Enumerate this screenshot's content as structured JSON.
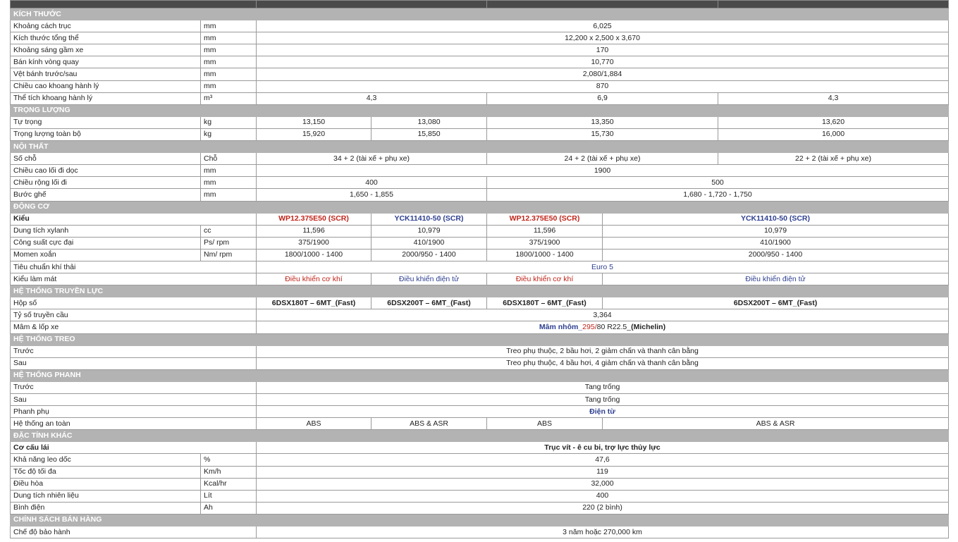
{
  "sections": {
    "dims": "KÍCH THƯỚC",
    "weight": "TRỌNG LƯỢNG",
    "interior": "NỘI THẤT",
    "engine": "ĐỘNG CƠ",
    "trans": "HỆ THỐNG TRUYỀN LỰC",
    "susp": "HỆ THỐNG TREO",
    "brake": "HỆ THỐNG PHANH",
    "other": "ĐẶC TÍNH KHÁC",
    "sales": "CHÍNH SÁCH BÁN HÀNG"
  },
  "rows": {
    "wheelbase": {
      "label": "Khoảng cách trục",
      "unit": "mm",
      "v": "6,025"
    },
    "overall": {
      "label": "Kích thước tổng thể",
      "unit": "mm",
      "v": "12,200 x 2,500 x 3,670"
    },
    "clearance": {
      "label": "Khoảng sáng gầm xe",
      "unit": "mm",
      "v": "170"
    },
    "turning": {
      "label": "Bán kính vòng quay",
      "unit": "mm",
      "v": "10,770"
    },
    "track": {
      "label": "Vệt bánh trước/sau",
      "unit": "mm",
      "v": "2,080/1,884"
    },
    "lugh": {
      "label": "Chiều cao khoang hành lý",
      "unit": "mm",
      "v": "870"
    },
    "lugv": {
      "label": "Thể tích khoang hành lý",
      "unit": "m³",
      "v1": "4,3",
      "v2": "6,9",
      "v3": "4,3"
    },
    "curb": {
      "label": "Tự trọng",
      "unit": "kg",
      "v1": "13,150",
      "v2": "13,080",
      "v3": "13,350",
      "v4": "13,620"
    },
    "gross": {
      "label": "Trọng lượng toàn bộ",
      "unit": "kg",
      "v1": "15,920",
      "v2": "15,850",
      "v3": "15,730",
      "v4": "16,000"
    },
    "seats": {
      "label": "Số chỗ",
      "unit": "Chỗ",
      "v1": "34 + 2 (tài xế + phụ xe)",
      "v2": "24 + 2 (tài xế + phụ xe)",
      "v3": "22 + 2 (tài xế + phụ xe)"
    },
    "aisleh": {
      "label": "Chiều cao lối đi dọc",
      "unit": "mm",
      "v": "1900"
    },
    "aislew": {
      "label": "Chiều rộng lối đi",
      "unit": "mm",
      "v1": "400",
      "v2": "500"
    },
    "pitch": {
      "label": "Bước ghế",
      "unit": "mm",
      "v1": "1,650 - 1,855",
      "v2": "1,680 - 1,720 - 1,750"
    },
    "etype": {
      "label": "Kiểu",
      "v1": "WP12.375E50 (SCR)",
      "v2": "YCK11410-50 (SCR)",
      "v3": "WP12.375E50 (SCR)",
      "v4": "YCK11410-50 (SCR)"
    },
    "disp": {
      "label": "Dung tích xylanh",
      "unit": "cc",
      "v1": "11,596",
      "v2": "10,979",
      "v3": "11,596",
      "v4": "10,979"
    },
    "power": {
      "label": "Công suất cực đại",
      "unit": "Ps/ rpm",
      "v1": "375/1900",
      "v2": "410/1900",
      "v3": "375/1900",
      "v4": "410/1900"
    },
    "torque": {
      "label": "Momen xoắn",
      "unit": "Nm/ rpm",
      "v1": "1800/1000 - 1400",
      "v2": "2000/950 - 1400",
      "v3": "1800/1000 - 1400",
      "v4": "2000/950 - 1400"
    },
    "emis": {
      "label": "Tiêu chuẩn khí thải",
      "v": "Euro 5"
    },
    "cool": {
      "label": "Kiểu làm mát",
      "v1": "Điều khiển cơ khí",
      "v2": "Điều khiển điện tử",
      "v3": "Điều khiển cơ khí",
      "v4": "Điều khiển điện tử"
    },
    "gearbox": {
      "label": "Hộp số",
      "v1": "6DSX180T – 6MT_(Fast)",
      "v2": "6DSX200T – 6MT_(Fast)",
      "v3": "6DSX180T – 6MT_(Fast)",
      "v4": "6DSX200T – 6MT_(Fast)"
    },
    "ratio": {
      "label": "Tỷ số truyền cầu",
      "v": "3,364"
    },
    "tyre": {
      "label": "Mâm & lốp xe",
      "a": "Mâm nhôm_",
      "b": "295/",
      "c": "80 R22.5_",
      "d": "(Michelin)"
    },
    "sfront": {
      "label": "Trước",
      "v": "Treo phụ thuộc, 2 bầu hơi, 2 giảm chấn và thanh cân bằng"
    },
    "srear": {
      "label": "Sau",
      "v": "Treo phụ thuộc, 4 bầu hơi, 4 giảm chấn và thanh cân bằng"
    },
    "bfront": {
      "label": "Trước",
      "v": "Tang trống"
    },
    "brear": {
      "label": "Sau",
      "v": "Tang trống"
    },
    "baux": {
      "label": "Phanh phụ",
      "v": "Điện từ"
    },
    "safety": {
      "label": "Hệ thống an toàn",
      "v1": "ABS",
      "v2": "ABS & ASR",
      "v3": "ABS",
      "v4": "ABS & ASR"
    },
    "steer": {
      "label": "Cơ cấu lái",
      "v": "Trục vít - ê cu bi, trợ lực thủy lực"
    },
    "grade": {
      "label": "Khả năng leo dốc",
      "unit": "%",
      "v": "47,6"
    },
    "speed": {
      "label": "Tốc độ tối đa",
      "unit": "Km/h",
      "v": "119"
    },
    "ac": {
      "label": "Điều hòa",
      "unit": "Kcal/hr",
      "v": "32,000"
    },
    "fuel": {
      "label": "Dung tích nhiên liệu",
      "unit": "Lít",
      "v": "400"
    },
    "batt": {
      "label": "Bình điện",
      "unit": "Ah",
      "v": "220 (2 bình)"
    },
    "warranty": {
      "label": "Chế độ bảo hành",
      "v": "3 năm hoặc 270,000 km"
    }
  }
}
